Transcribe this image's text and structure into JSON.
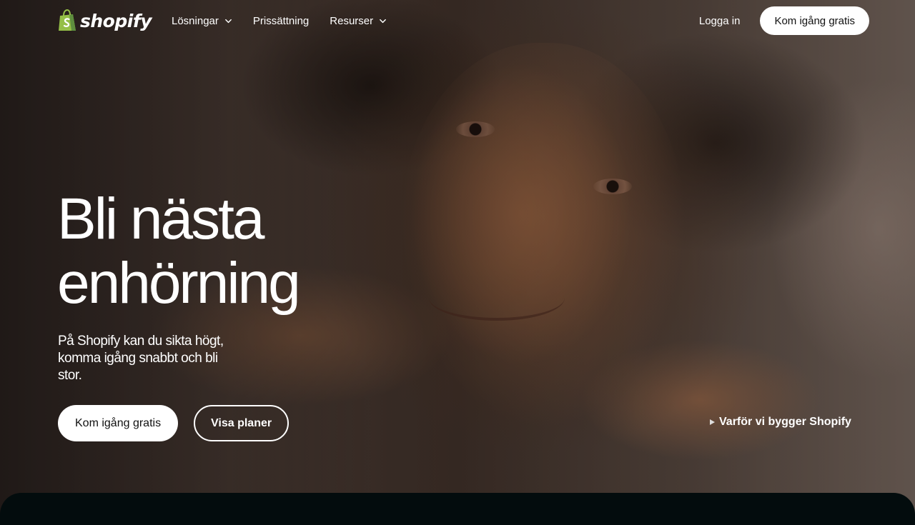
{
  "brand": {
    "name": "shopify",
    "logo_icon": "shopping-bag-icon",
    "logo_color": "#95BF47"
  },
  "nav": {
    "items": [
      {
        "label": "Lösningar",
        "has_dropdown": true
      },
      {
        "label": "Prissättning",
        "has_dropdown": false
      },
      {
        "label": "Resurser",
        "has_dropdown": true
      }
    ],
    "login_label": "Logga in",
    "cta_label": "Kom igång gratis"
  },
  "hero": {
    "title_line1": "Bli nästa",
    "title_line2": "enhörning",
    "subtitle": "På Shopify kan du sikta högt, komma igång snabbt och bli stor.",
    "primary_button": "Kom igång gratis",
    "secondary_button": "Visa planer",
    "video_link": "Varför vi bygger Shopify"
  },
  "colors": {
    "text": "#FFFFFF",
    "button_bg": "#FFFFFF",
    "button_text": "#111111",
    "bottom_panel": "#030C0D"
  }
}
